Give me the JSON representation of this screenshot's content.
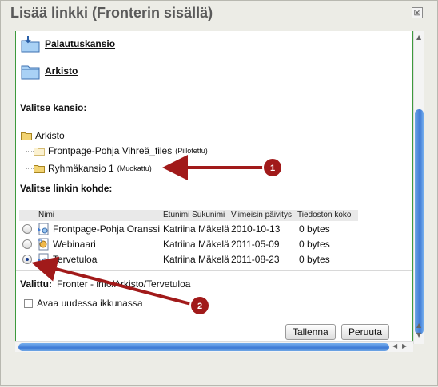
{
  "dialog": {
    "title": "Lisää linkki (Fronterin sisällä)",
    "close_symbol": "⊠"
  },
  "folders": [
    {
      "label": "Palautuskansio",
      "icon": "inbox-folder-icon"
    },
    {
      "label": "Arkisto",
      "icon": "folder-icon"
    }
  ],
  "choose_folder": {
    "title": "Valitse kansio:",
    "tree": {
      "root": "Arkisto",
      "children": [
        {
          "name": "Frontpage-Pohja Vihreä_files",
          "tag": "(Piilotettu)"
        },
        {
          "name": "Ryhmäkansio 1",
          "tag": "(Muokattu)"
        }
      ]
    }
  },
  "choose_target": {
    "title": "Valitse linkin kohde:",
    "columns": [
      "Nimi",
      "Etunimi Sukunimi",
      "Viimeisin päivitys",
      "Tiedoston koko"
    ],
    "rows": [
      {
        "name": "Frontpage-Pohja Oranssi",
        "author": "Katriina Mäkelä",
        "date": "2010-10-13",
        "size": "0 bytes",
        "selected": false
      },
      {
        "name": "Webinaari",
        "author": "Katriina Mäkelä",
        "date": "2011-05-09",
        "size": "0 bytes",
        "selected": false
      },
      {
        "name": "Tervetuloa",
        "author": "Katriina Mäkelä",
        "date": "2011-08-23",
        "size": "0 bytes",
        "selected": true
      }
    ]
  },
  "selected": {
    "label": "Valittu:",
    "value": "Fronter - info/Arkisto/Tervetuloa"
  },
  "new_window": {
    "label": "Avaa uudessa ikkunassa",
    "checked": false
  },
  "buttons": {
    "save": "Tallenna",
    "cancel": "Peruuta"
  },
  "callouts": [
    "1",
    "2"
  ],
  "colors": {
    "accent": "#3e7ad5",
    "callout": "#a11a1a",
    "border": "#3d9a3d"
  }
}
